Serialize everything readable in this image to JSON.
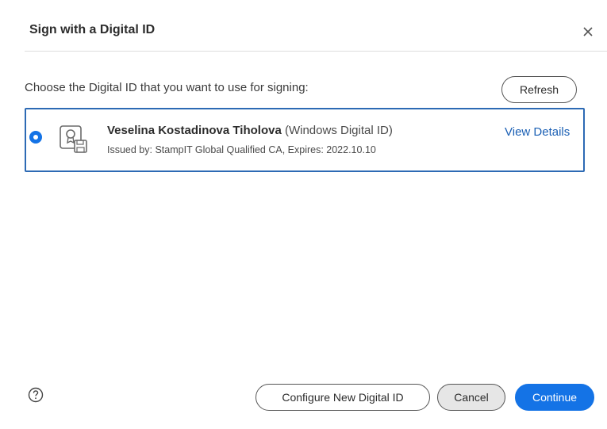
{
  "dialog": {
    "title": "Sign with a Digital ID",
    "close_glyph": "×"
  },
  "prompt": "Choose the Digital ID that you want to use for signing:",
  "refresh_label": "Refresh",
  "digital_ids": [
    {
      "selected": true,
      "name": "Veselina Kostadinova Tiholova",
      "type": "(Windows Digital ID)",
      "meta": "Issued by: StampIT Global Qualified CA, Expires: 2022.10.10",
      "view_details_label": "View Details",
      "icon": "certificate-icon"
    }
  ],
  "footer": {
    "help_icon": "help-icon",
    "configure_label": "Configure New Digital ID",
    "cancel_label": "Cancel",
    "continue_label": "Continue"
  },
  "colors": {
    "accent": "#1473e6",
    "card_border": "#2d6ab4",
    "link": "#1a5fb4"
  }
}
